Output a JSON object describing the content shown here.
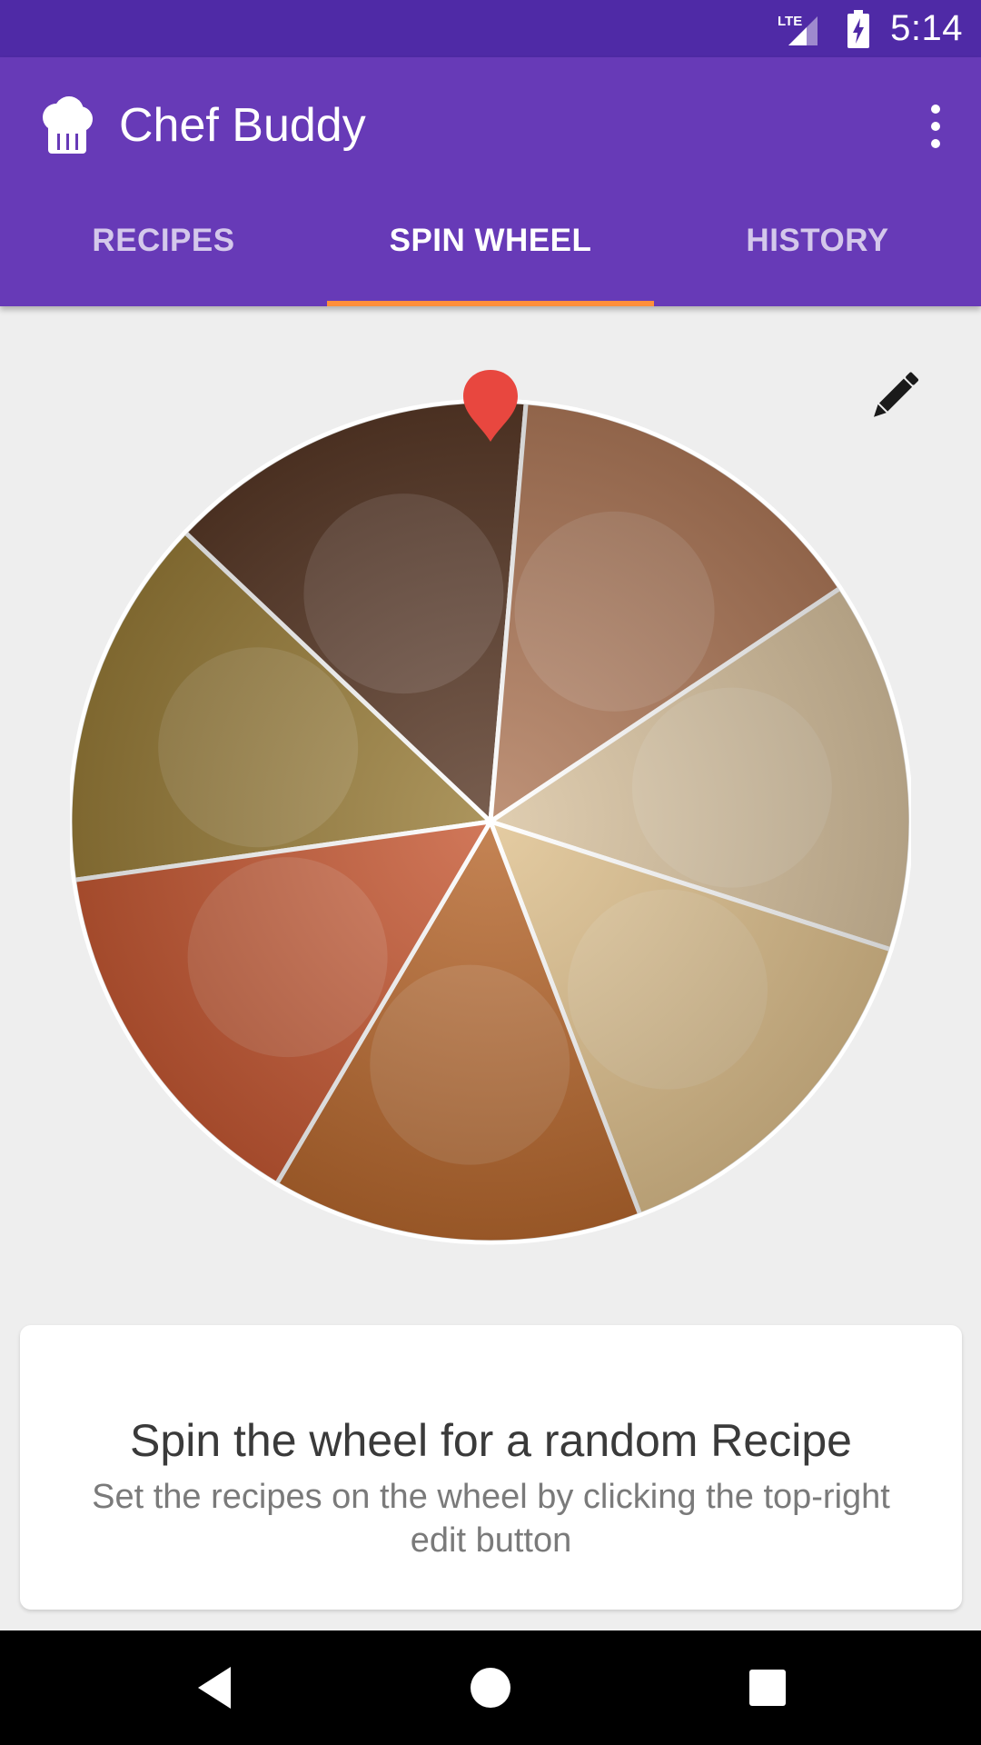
{
  "status_bar": {
    "network": "LTE",
    "time": "5:14",
    "icons": [
      "lte-signal-icon",
      "battery-charging-icon"
    ]
  },
  "app_bar": {
    "title": "Chef Buddy",
    "logo_icon": "chef-hat-icon",
    "menu_icon": "more-vert-icon",
    "background": "#673ab7"
  },
  "tabs": [
    {
      "label": "RECIPES",
      "active": false
    },
    {
      "label": "SPIN WHEEL",
      "active": true
    },
    {
      "label": "HISTORY",
      "active": false
    }
  ],
  "tab_indicator_color": "#ff8f3b",
  "wheel": {
    "pointer_color": "#e8473f",
    "edit_icon": "edit-pencil-icon",
    "segments": [
      {
        "name": "noodle-salad-slice",
        "color": "#9a7e3a"
      },
      {
        "name": "chocolate-cake-slice",
        "color": "#5a3a28"
      },
      {
        "name": "burger-slice",
        "color": "#b07a5a"
      },
      {
        "name": "soup-slice",
        "color": "#d9c3a0"
      },
      {
        "name": "pancakes-slice",
        "color": "#dfc18e"
      },
      {
        "name": "spaghetti-slice",
        "color": "#b8692f"
      },
      {
        "name": "pizza-slice",
        "color": "#c75a35"
      }
    ]
  },
  "card": {
    "title": "Spin the wheel for a random Recipe",
    "subtitle": "Set the recipes on the wheel by clicking the top-right edit button"
  },
  "nav_bar": {
    "icons": [
      "back-icon",
      "home-icon",
      "recents-icon"
    ]
  }
}
